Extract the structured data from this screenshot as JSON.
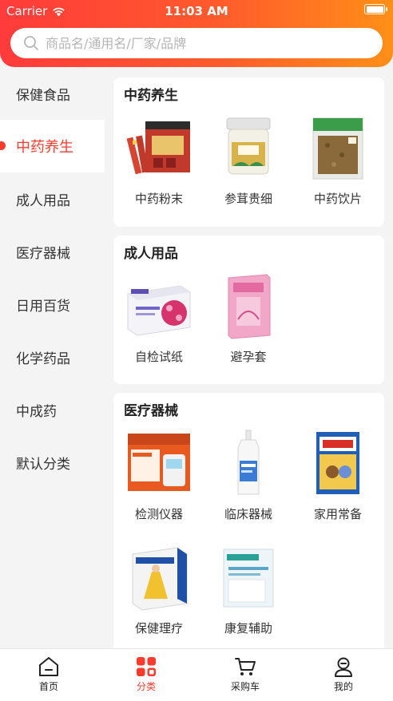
{
  "status_bar": {
    "carrier": "Carrier",
    "time": "11:03 AM"
  },
  "search": {
    "placeholder": "商品名/通用名/厂家/品牌"
  },
  "sidebar": {
    "items": [
      {
        "label": "保健食品",
        "active": false
      },
      {
        "label": "中药养生",
        "active": true
      },
      {
        "label": "成人用品",
        "active": false
      },
      {
        "label": "医疗器械",
        "active": false
      },
      {
        "label": "日用百货",
        "active": false
      },
      {
        "label": "化学药品",
        "active": false
      },
      {
        "label": "中成药",
        "active": false
      },
      {
        "label": "默认分类",
        "active": false
      }
    ]
  },
  "sections": [
    {
      "title": "中药养生",
      "products": [
        {
          "label": "中药粉末",
          "icon": "herbal-powder-box-icon"
        },
        {
          "label": "参茸贵细",
          "icon": "ginseng-jar-icon"
        },
        {
          "label": "中药饮片",
          "icon": "herbal-slices-bag-icon"
        }
      ]
    },
    {
      "title": "成人用品",
      "products": [
        {
          "label": "自检试纸",
          "icon": "test-strip-box-icon"
        },
        {
          "label": "避孕套",
          "icon": "condom-box-icon"
        }
      ]
    },
    {
      "title": "医疗器械",
      "products": [
        {
          "label": "检测仪器",
          "icon": "glucose-strip-box-icon"
        },
        {
          "label": "临床器械",
          "icon": "medical-bottle-icon"
        },
        {
          "label": "家用常备",
          "icon": "bandage-box-icon"
        },
        {
          "label": "保健理疗",
          "icon": "therapy-box-icon"
        },
        {
          "label": "康复辅助",
          "icon": "rehab-bag-icon"
        }
      ]
    }
  ],
  "tabbar": {
    "items": [
      {
        "label": "首页",
        "icon": "home-icon",
        "active": false
      },
      {
        "label": "分类",
        "icon": "category-icon",
        "active": true
      },
      {
        "label": "采购车",
        "icon": "cart-icon",
        "active": false
      },
      {
        "label": "我的",
        "icon": "profile-icon",
        "active": false
      }
    ]
  },
  "colors": {
    "accent": "#ff3a2c",
    "header_start": "#ff3b3b",
    "header_end": "#ff8f17"
  }
}
